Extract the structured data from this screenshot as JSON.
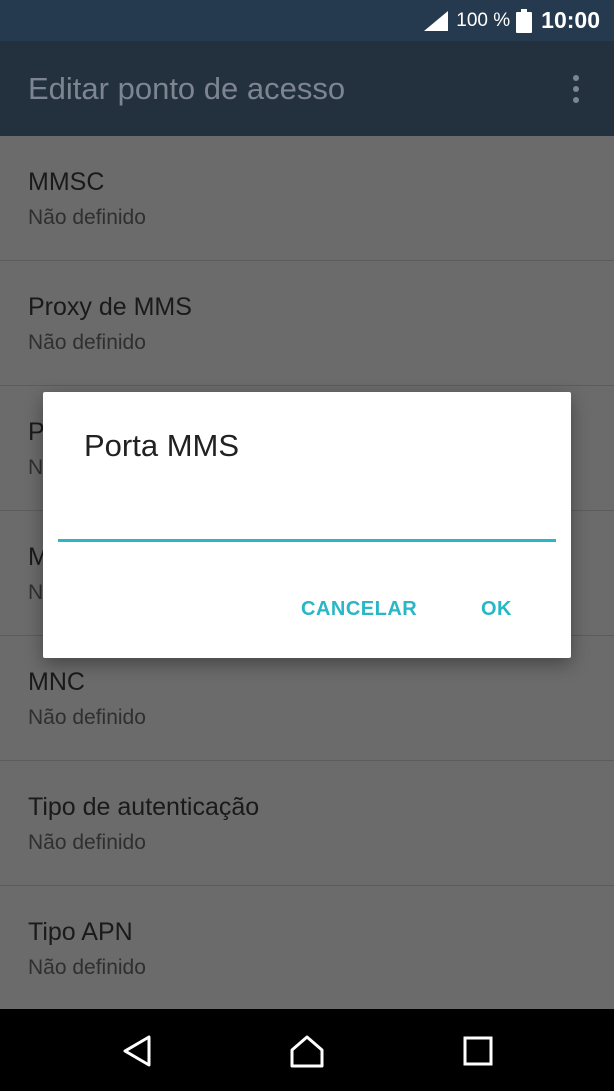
{
  "status_bar": {
    "battery_percent": "100 %",
    "time": "10:00",
    "icons": [
      "signal-icon",
      "battery-icon"
    ]
  },
  "app_bar": {
    "title": "Editar ponto de acesso",
    "menu_icon": "more-vert-icon"
  },
  "list": {
    "items": [
      {
        "title": "MMSC",
        "value": "Não definido"
      },
      {
        "title": "Proxy de MMS",
        "value": "Não definido"
      },
      {
        "title": "P",
        "value": "N"
      },
      {
        "title": "M",
        "value": "N"
      },
      {
        "title": "MNC",
        "value": "Não definido"
      },
      {
        "title": "Tipo de autenticação",
        "value": "Não definido"
      },
      {
        "title": "Tipo APN",
        "value": "Não definido"
      }
    ]
  },
  "dialog": {
    "title": "Porta MMS",
    "input_value": "",
    "cancel_label": "CANCELAR",
    "ok_label": "OK",
    "accent_color": "#29b6c6"
  },
  "nav_bar": {
    "icons": [
      "back-icon",
      "home-icon",
      "recents-icon"
    ]
  }
}
